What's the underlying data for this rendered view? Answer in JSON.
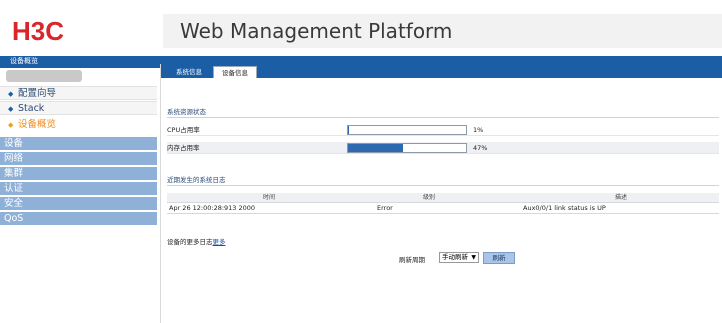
{
  "header": {
    "logo_text": "H3C",
    "title": "Web Management Platform",
    "top_label": "设备概览"
  },
  "sidebar": {
    "items": [
      {
        "label": "配置向导",
        "bullet": "◆"
      },
      {
        "label": "Stack",
        "bullet": "◆"
      },
      {
        "label": "设备概览",
        "bullet": "◆"
      },
      {
        "label": "设备"
      },
      {
        "label": "网络"
      },
      {
        "label": "集群"
      },
      {
        "label": "认证"
      },
      {
        "label": "安全"
      },
      {
        "label": "QoS"
      }
    ]
  },
  "tabs": [
    "系统信息",
    "设备信息"
  ],
  "resources": {
    "section_title": "系统资源状态",
    "rows": [
      {
        "label": "CPU占用率",
        "value": "1%",
        "percent": 1
      },
      {
        "label": "内存占用率",
        "value": "47%",
        "percent": 47
      }
    ]
  },
  "log": {
    "section_title": "近期发生的系统日志",
    "headers": [
      "时间",
      "级别",
      "描述"
    ],
    "rows": [
      {
        "time": "Apr 26 12:00:28:913 2000",
        "level": "Error",
        "description": "Aux0/0/1 link status is UP"
      }
    ]
  },
  "more_logs": {
    "prefix": "设备的更多日志",
    "link": "更多"
  },
  "refresh": {
    "label": "刷新周期",
    "selected": "手动刷新",
    "button": "刷新"
  }
}
